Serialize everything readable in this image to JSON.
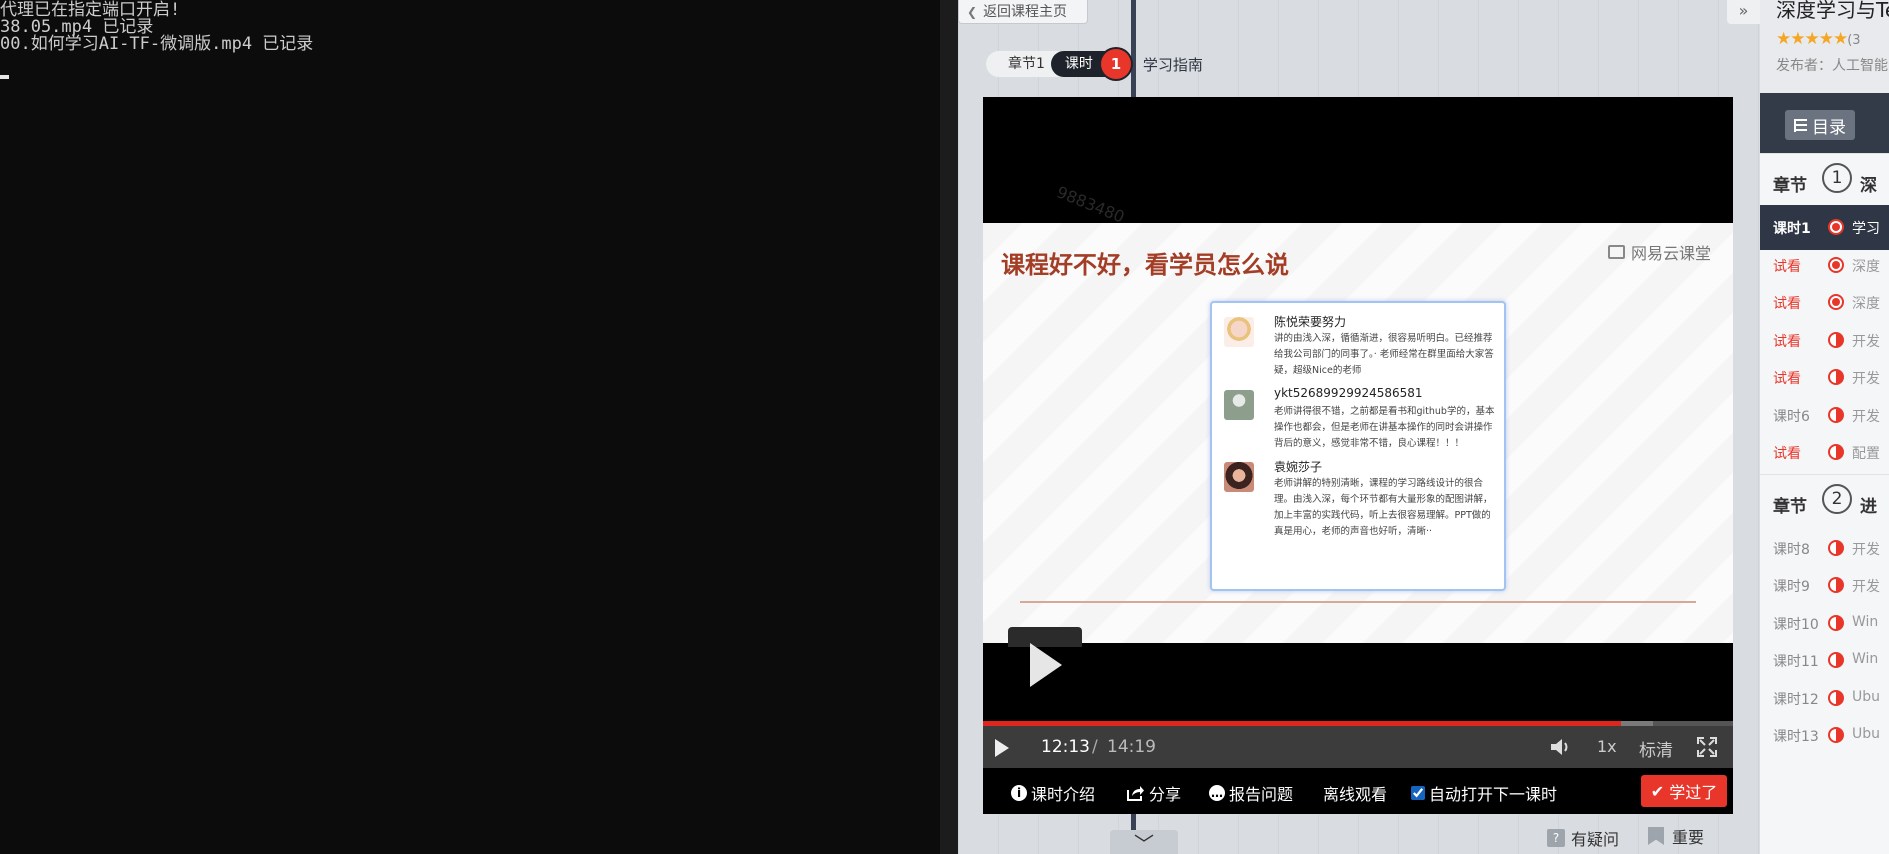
{
  "terminal": {
    "lines": [
      "代理已在指定端口开启!",
      "38.05.mp4 已记录",
      "00.如何学习AI-TF-微调版.mp4 已记录"
    ]
  },
  "course": {
    "back_label": "返回课程主页",
    "breadcrumb": {
      "chapter": "章节1",
      "lesson": "课时",
      "badge": "1",
      "title": "学习指南"
    },
    "collapse_label": "»",
    "player": {
      "watermark": "9883480",
      "slide": {
        "title": "课程好不好，看学员怎么说",
        "brand": "网易云课堂",
        "reviews": [
          {
            "name": "陈悦荣要努力",
            "body": "讲的由浅入深，循循渐进，很容易听明白。已经推荐给我公司部门的同事了。· 老师经常在群里面给大家答疑，超级Nice的老师"
          },
          {
            "name": "ykt52689929924586581",
            "body": "老师讲得很不错，之前都是看书和github学的，基本操作也都会，但是老师在讲基本操作的同时会讲操作背后的意义，感觉非常不错，良心课程！！！"
          },
          {
            "name": "袁婉莎子",
            "body": "老师讲解的特别清晰，课程的学习路线设计的很合理。由浅入深，每个环节都有大量形象的配图讲解，加上丰富的实践代码，听上去很容易理解。PPT做的真是用心，老师的声音也好听，清晰··"
          }
        ]
      },
      "progress": 0.8513,
      "buffered": 0.8933,
      "current_time": "12:13",
      "separator": "/",
      "duration": "14:19",
      "speed": "1x",
      "quality": "标清",
      "actions": {
        "intro": "课时介绍",
        "share": "分享",
        "report": "报告问题",
        "offline": "离线观看",
        "autoplay": "自动打开下一课时",
        "autoplay_checked": true,
        "learned": "学过了"
      }
    },
    "doubt_label": "有疑问",
    "important_label": "重要",
    "down_label": "﹀"
  },
  "sidebar": {
    "title": "深度学习与Te",
    "stars": "★★★★★",
    "rating": "(3",
    "publisher": "发布者：人工智能",
    "toc_label": "目录",
    "chapters": [
      {
        "label": "章节",
        "num": "1",
        "text": "深"
      },
      {
        "label": "章节",
        "num": "2",
        "text": "进"
      }
    ],
    "rows": [
      {
        "label": "课时1",
        "text": "学习",
        "trial": false,
        "active": true,
        "dot": "full"
      },
      {
        "label": "试看",
        "text": "深度",
        "trial": true,
        "active": false,
        "dot": "full"
      },
      {
        "label": "试看",
        "text": "深度",
        "trial": true,
        "active": false,
        "dot": "full"
      },
      {
        "label": "试看",
        "text": "开发",
        "trial": true,
        "active": false,
        "dot": "half"
      },
      {
        "label": "试看",
        "text": "开发",
        "trial": true,
        "active": false,
        "dot": "half"
      },
      {
        "label": "课时6",
        "text": "开发",
        "trial": false,
        "active": false,
        "dot": "half"
      },
      {
        "label": "试看",
        "text": "配置",
        "trial": true,
        "active": false,
        "dot": "half"
      },
      {
        "label": "课时8",
        "text": "开发",
        "trial": false,
        "active": false,
        "dot": "half"
      },
      {
        "label": "课时9",
        "text": "开发",
        "trial": false,
        "active": false,
        "dot": "half"
      },
      {
        "label": "课时10",
        "text": "Win",
        "trial": false,
        "active": false,
        "dot": "half"
      },
      {
        "label": "课时11",
        "text": "Win",
        "trial": false,
        "active": false,
        "dot": "half"
      },
      {
        "label": "课时12",
        "text": "Ubu",
        "trial": false,
        "active": false,
        "dot": "half"
      },
      {
        "label": "课时13",
        "text": "Ubu",
        "trial": false,
        "active": false,
        "dot": "half"
      }
    ]
  }
}
